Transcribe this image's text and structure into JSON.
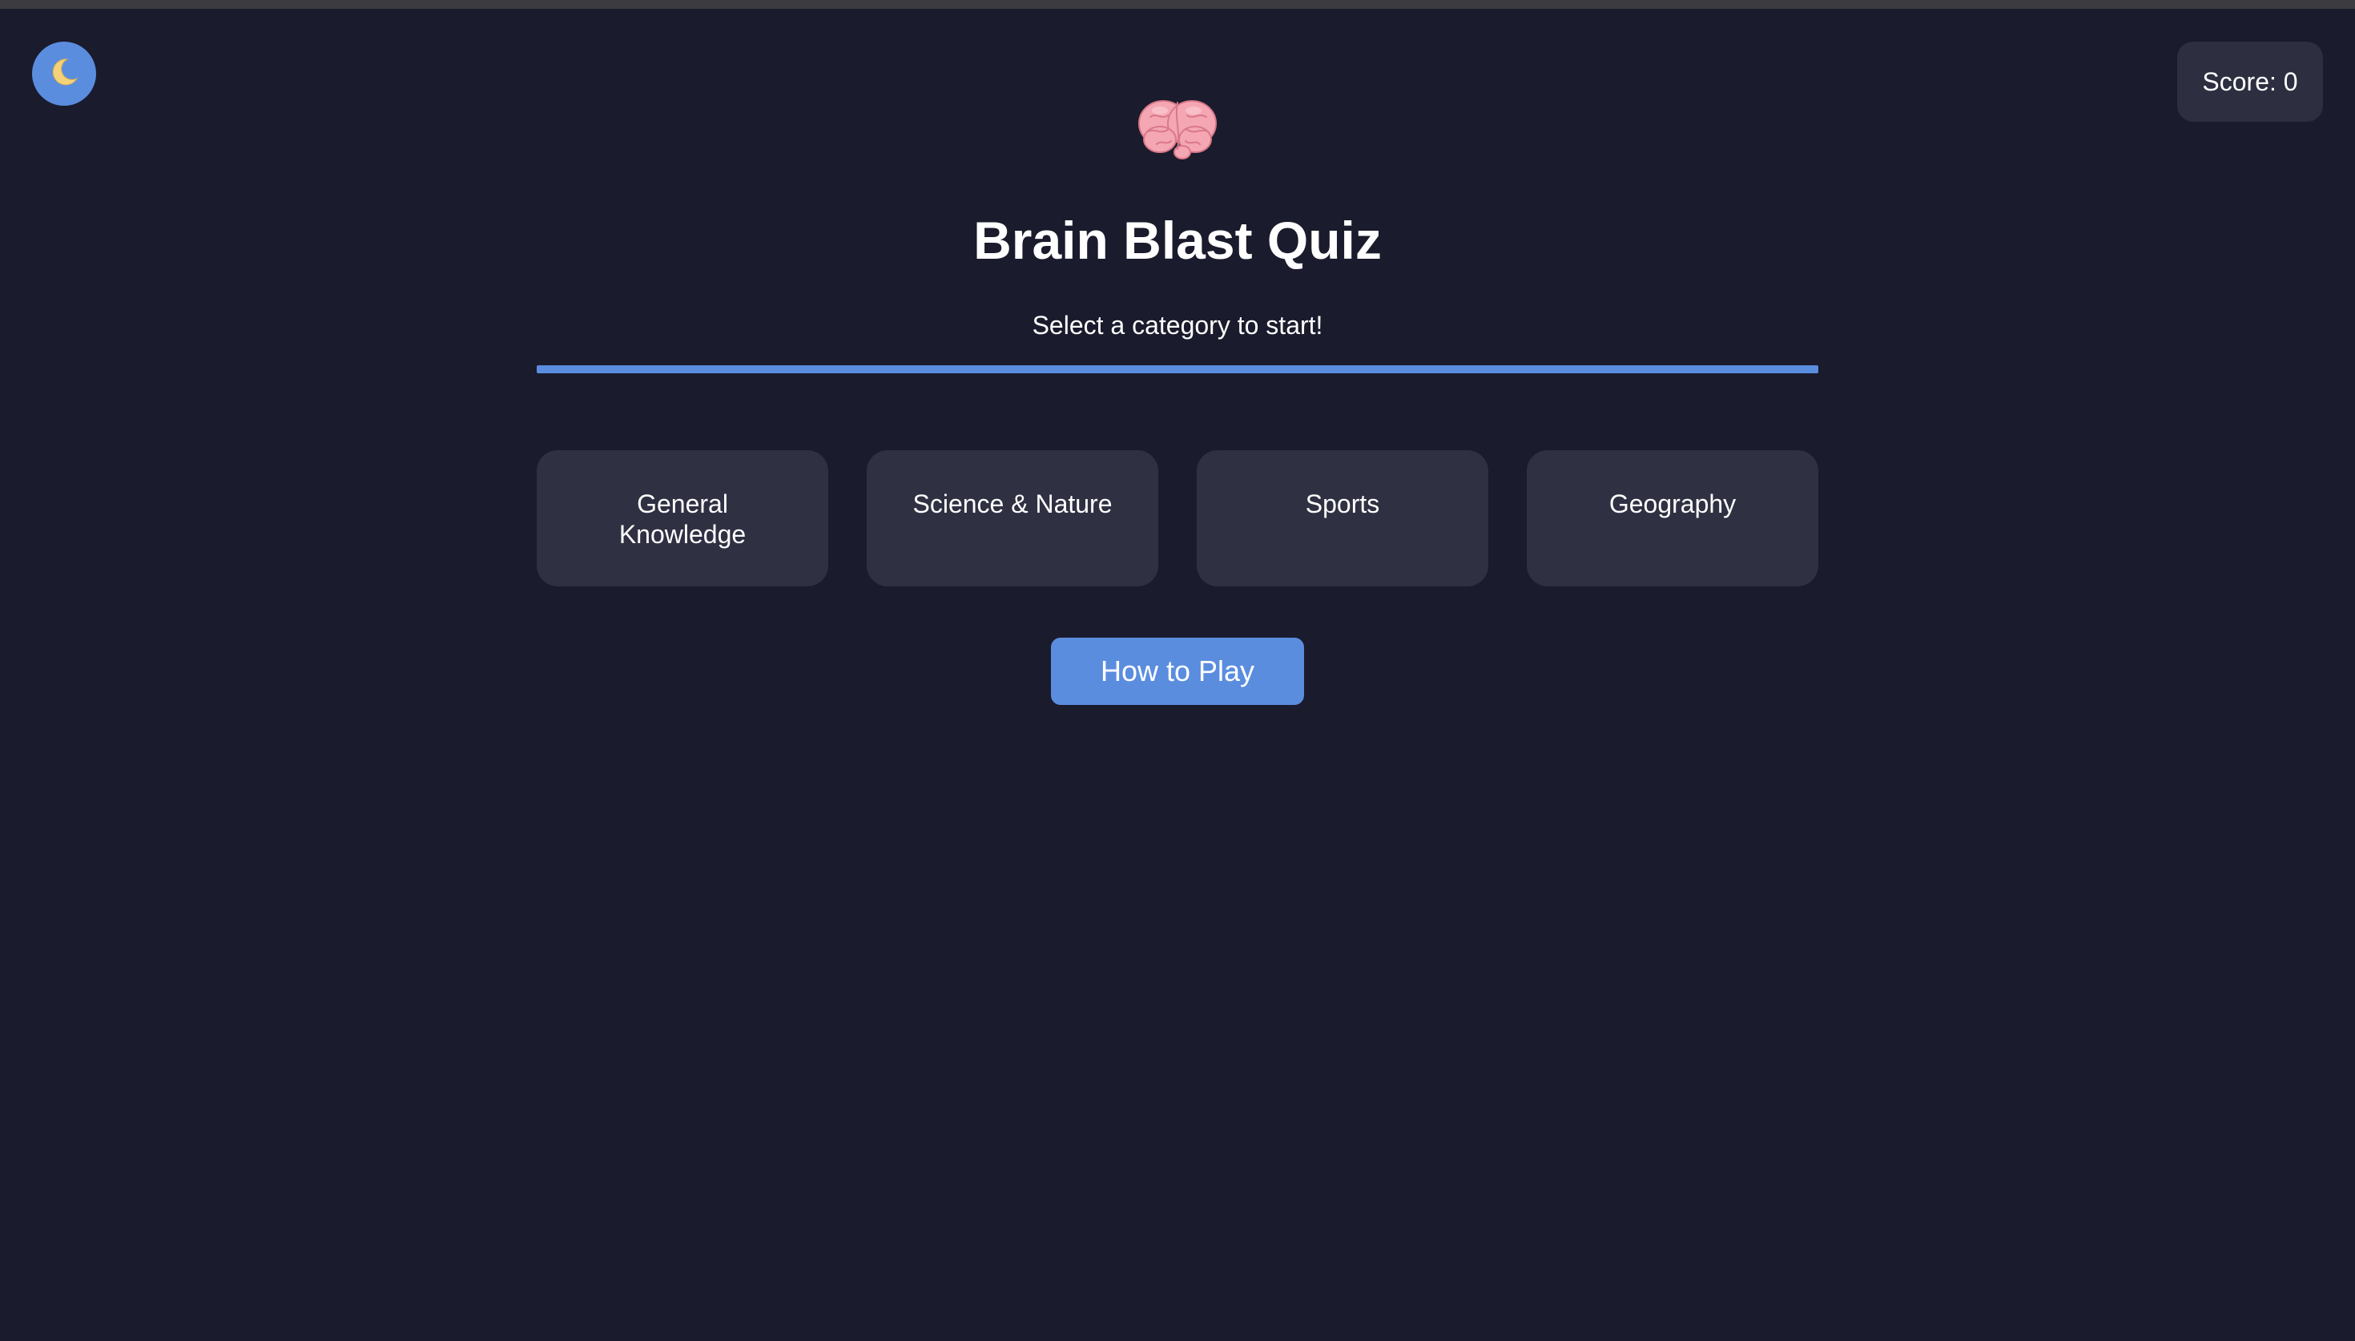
{
  "app": {
    "title": "Brain Blast Quiz",
    "subtitle": "Select a category to start!"
  },
  "header": {
    "theme_toggle_icon": "moon-icon",
    "score_text": "Score: 0"
  },
  "logo": {
    "icon": "brain-icon"
  },
  "progress": {
    "fill_fraction": 1.0
  },
  "categories": [
    {
      "label": "General Knowledge"
    },
    {
      "label": "Science & Nature"
    },
    {
      "label": "Sports"
    },
    {
      "label": "Geography"
    }
  ],
  "actions": {
    "how_to_play_label": "How to Play"
  },
  "colors": {
    "background": "#1a1b2c",
    "card": "#2f3042",
    "accent": "#5b8ddf",
    "text": "#ffffff"
  }
}
